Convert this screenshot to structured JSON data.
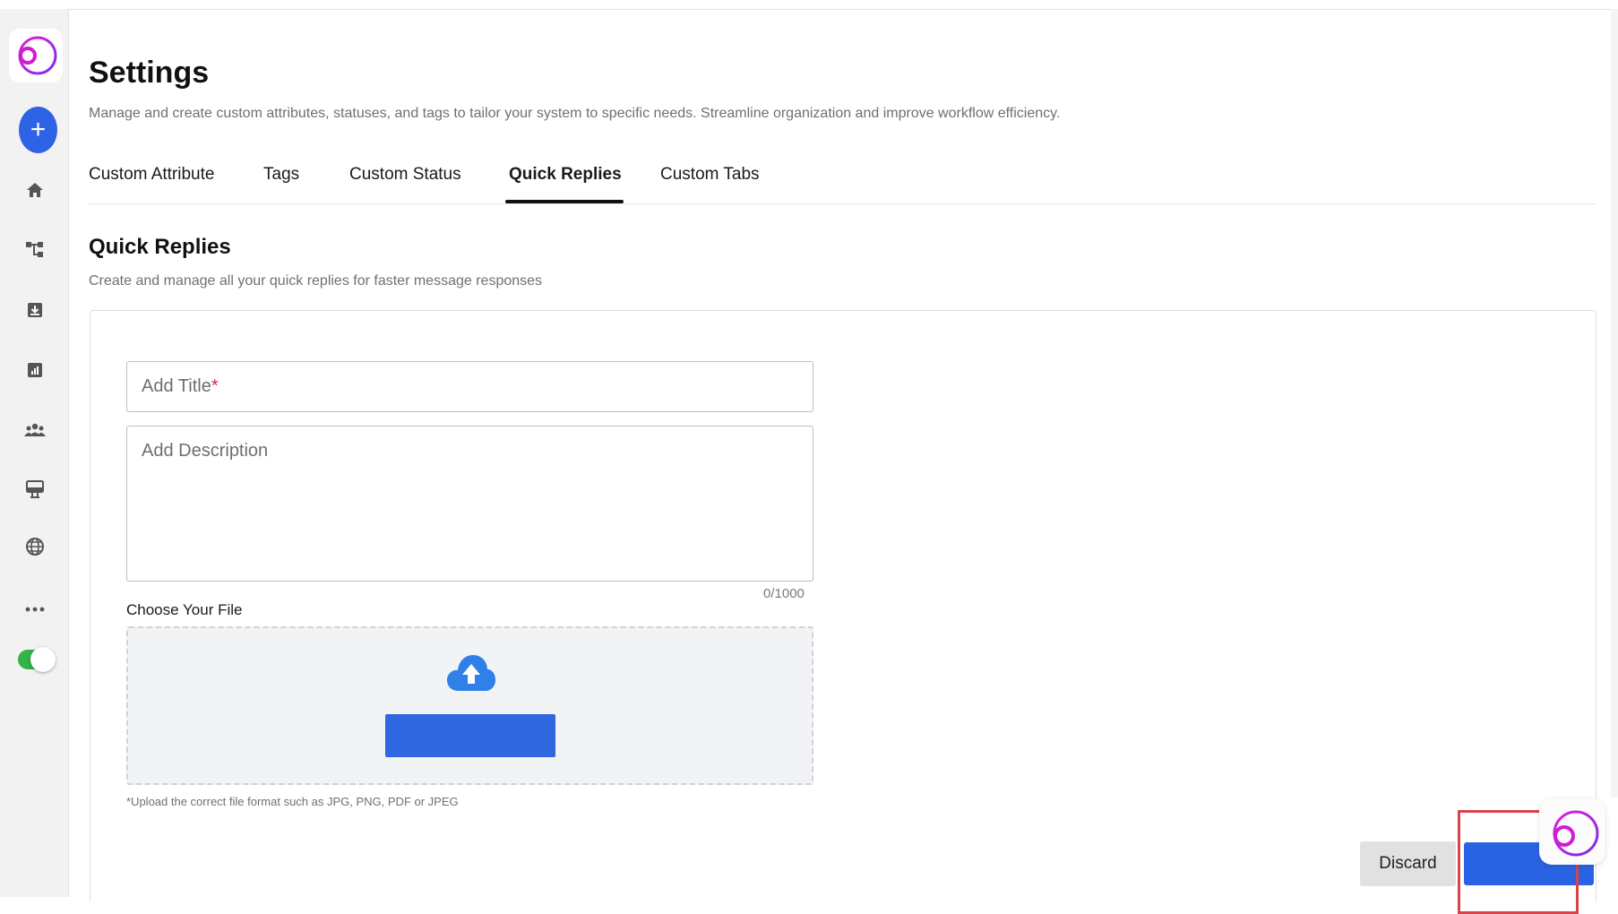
{
  "header": {
    "title": "Settings",
    "subtitle": "Manage and create custom attributes, statuses, and tags to tailor your system to specific needs. Streamline organization and improve workflow efficiency."
  },
  "tabs": [
    {
      "label": "Custom Attribute",
      "active": false
    },
    {
      "label": "Tags",
      "active": false
    },
    {
      "label": "Custom Status",
      "active": false
    },
    {
      "label": "Quick Replies",
      "active": true
    },
    {
      "label": "Custom Tabs",
      "active": false
    }
  ],
  "section": {
    "title": "Quick Replies",
    "subtitle": "Create and manage all your quick replies for faster message responses"
  },
  "form": {
    "title_placeholder": "Add Title",
    "title_required_mark": "*",
    "description_placeholder": "Add Description",
    "char_counter": "0/1000",
    "file_label": "Choose Your File",
    "upload_button_label": "",
    "file_note": "*Upload the correct file format such as JPG, PNG, PDF or JPEG"
  },
  "actions": {
    "discard_label": "Discard",
    "save_label": ""
  },
  "sidebar": {
    "icons": [
      "add-icon",
      "home-icon",
      "workflow-icon",
      "inbox-icon",
      "reports-icon",
      "team-icon",
      "campaign-icon",
      "globe-icon",
      "more-icon",
      "status-toggle"
    ],
    "toggle_on": true
  },
  "colors": {
    "primary": "#2f63e6",
    "brand_magenta": "#e11fd6",
    "brand_purple": "#7b2bf0",
    "toggle_green": "#34b34a",
    "required_red": "#e0243d",
    "highlight_red": "#d9434c"
  }
}
